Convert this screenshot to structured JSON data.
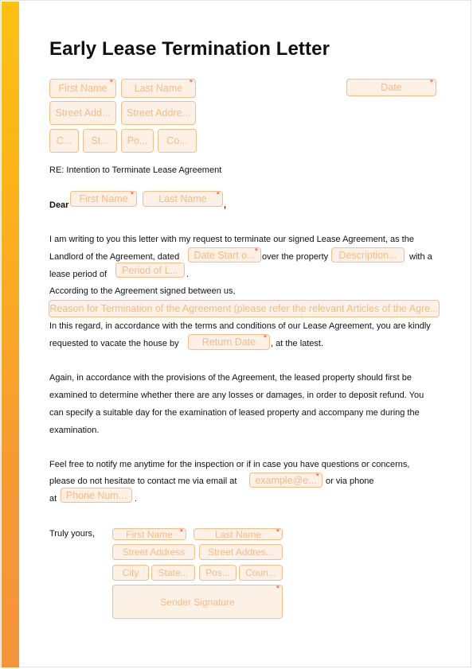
{
  "document": {
    "title": "Early Lease Termination Letter",
    "colors": {
      "accent_stripe_top": "#fdc112",
      "accent_stripe_bottom": "#f5953a",
      "field_border": "#f5bd8a",
      "field_fill": "#fdf1e6",
      "required_mark": "#e8453c"
    },
    "header_fields": {
      "first_name": "First Name",
      "last_name": "Last Name",
      "date": "Date",
      "street_address_1": "Street Add...",
      "street_address_2": "Street Addre...",
      "city": "C...",
      "state": "St...",
      "postal": "Po...",
      "country": "Co..."
    },
    "re_line": "RE: Intention to Terminate Lease Agreement",
    "salutation": {
      "dear": "Dear",
      "first_name": "First Name",
      "last_name": "Last Name",
      "comma": ","
    },
    "para1": {
      "line1": "I am writing to you this letter with my request to terminate our signed Lease Agreement, as the",
      "line2_a": "Landlord of the Agreement, dated",
      "date_start_field": "Date Start o...",
      "line2_b": "over the property",
      "description_field": "Description...",
      "line2_c": "with a",
      "line3_a": "lease period of",
      "period_field": "Period of L...",
      "line3_b": ".",
      "line4": "According to the Agreement signed between us,",
      "reason_field": "Reason for Termination of the Agreement (please refer the relevant Articles of the Agre...",
      "line5": "In this regard, in accordance with the terms and conditions of our Lease Agreement, you are kindly",
      "line6_a": "requested to vacate the house by",
      "return_date_field": "Return Date",
      "line6_b": ", at the latest."
    },
    "para2": {
      "line1": "Again, in accordance with the provisions of the Agreement, the leased property should first be",
      "line2": "examined to determine whether there are any losses or damages, in order to deposit refund. You",
      "line3": "can specify a suitable day for the examination of leased property and accompany me during the",
      "line4": "examination."
    },
    "para3": {
      "line1": "Feel free to notify me anytime for the inspection or if in case you have questions or concerns,",
      "line2_a": "please do not hesitate to contact me via email at",
      "email_field": "example@e...",
      "line2_b": "or via phone",
      "line3_a": "at",
      "phone_field": "Phone Num...",
      "line3_b": "."
    },
    "closing": {
      "label": "Truly yours,",
      "first_name": "First Name",
      "last_name": "Last Name",
      "street_address_1": "Street Address",
      "street_address_2": "Street Addres...",
      "city": "City",
      "state": "State...",
      "postal": "Pos...",
      "country": "Coun...",
      "signature": "Sender Signature"
    },
    "required_mark": "*"
  }
}
